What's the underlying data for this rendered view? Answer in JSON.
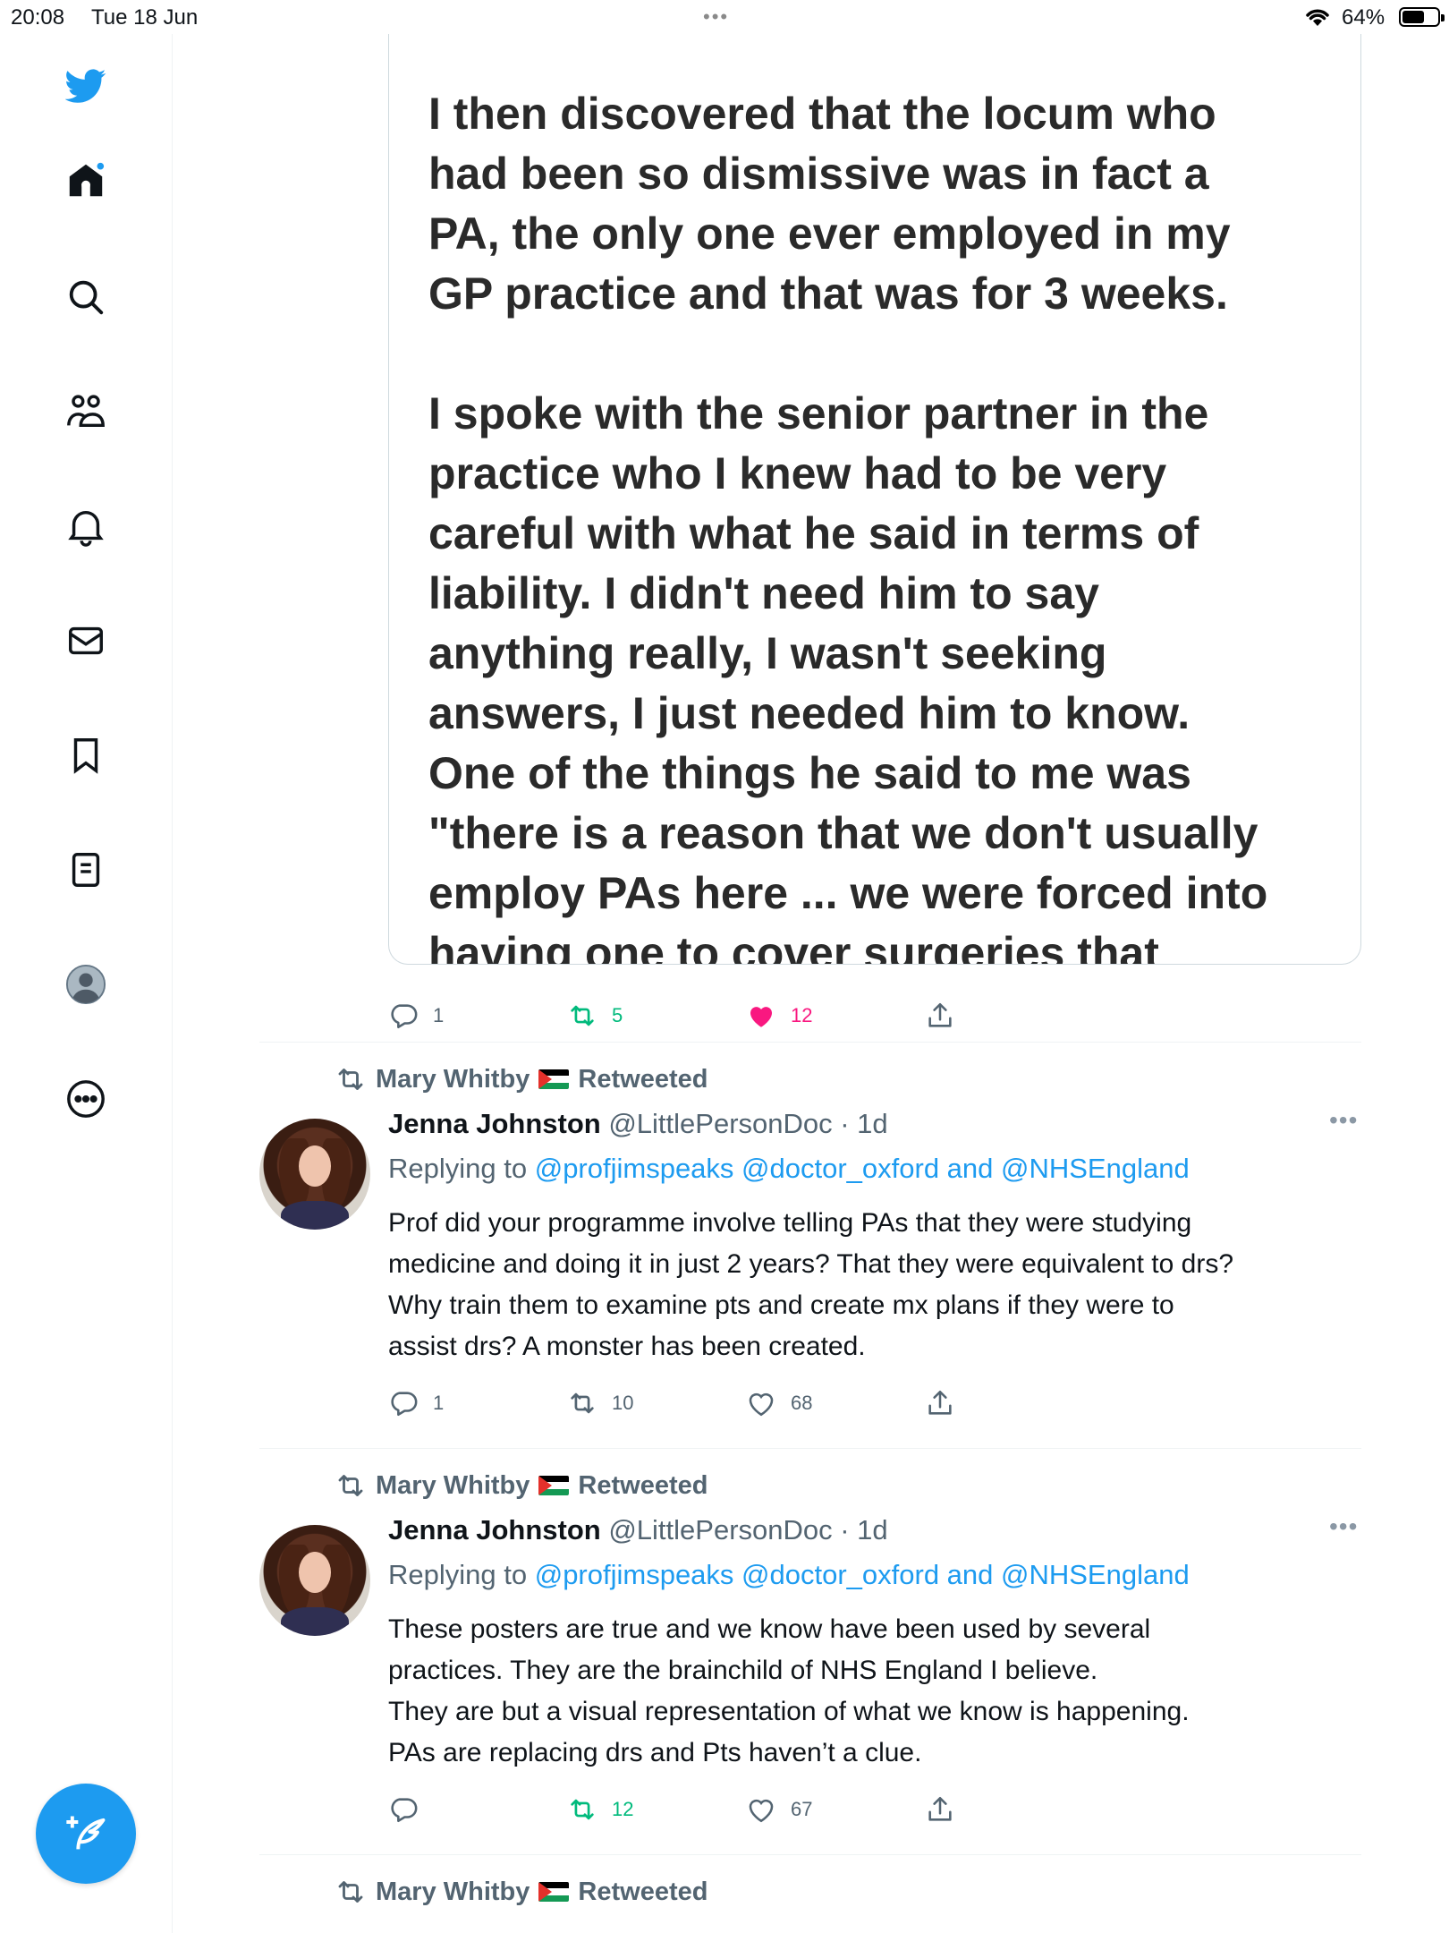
{
  "status_bar": {
    "time": "20:08",
    "date": "Tue 18 Jun",
    "battery_percent": "64%",
    "battery_level": 0.64
  },
  "sidebar": {
    "items": [
      {
        "icon": "twitter-bird-icon"
      },
      {
        "icon": "home-icon",
        "has_notification_dot": true
      },
      {
        "icon": "search-icon"
      },
      {
        "icon": "communities-icon"
      },
      {
        "icon": "bell-icon"
      },
      {
        "icon": "mail-icon"
      },
      {
        "icon": "bookmark-icon"
      },
      {
        "icon": "lists-icon"
      },
      {
        "icon": "profile-icon"
      },
      {
        "icon": "more-icon"
      }
    ],
    "compose_icon": "compose-tweet-icon"
  },
  "colors": {
    "accent": "#1d9bf0",
    "retweet_green": "#00ba7c",
    "like_pink": "#f91880",
    "secondary_text": "#536471"
  },
  "first_tweet": {
    "media_text": "I then discovered that the locum who\nhad been so dismissive was in fact a\nPA, the only one ever employed in my\nGP practice and that was for 3 weeks.\n\nI spoke with the senior partner in the\npractice who I knew had to be very\ncareful with what he said in terms of\nliability. I didn't need him to say\nanything really, I wasn't seeking\nanswers, I just needed him to know.\nOne of the things he said to me was\n\"there is a reason that we don't usually\nemploy PAs here ... we were forced into\nhaving one to cover surgeries that",
    "actions": {
      "replies": "1",
      "retweets": "5",
      "likes": "12"
    }
  },
  "tweets": [
    {
      "retweeted_by": "Mary Whitby",
      "retweeted_label": "Retweeted",
      "name": "Jenna Johnston",
      "handle_time": "@LittlePersonDoc · 1d",
      "replying_prefix": "Replying to ",
      "replying_links": "@profjimspeaks @doctor_oxford and @NHSEngland",
      "text": "Prof did your programme involve telling PAs that they were studying\nmedicine and doing it in just 2 years? That they were equivalent to drs?\nWhy train them to examine pts and create mx plans if they were to\nassist drs? A monster has been created.",
      "actions": {
        "replies": "1",
        "retweets": "10",
        "likes": "68"
      }
    },
    {
      "retweeted_by": "Mary Whitby",
      "retweeted_label": "Retweeted",
      "name": "Jenna Johnston",
      "handle_time": "@LittlePersonDoc · 1d",
      "replying_prefix": "Replying to ",
      "replying_links": "@profjimspeaks @doctor_oxford and @NHSEngland",
      "text": "These posters are true and we know have been used by several\npractices. They are the brainchild of NHS England I believe.\nThey are but a visual representation of what we know is happening.\nPAs are replacing drs and Pts haven’t a clue.",
      "actions": {
        "replies": "",
        "retweets": "12",
        "likes": "67"
      }
    },
    {
      "retweeted_by": "Mary Whitby",
      "retweeted_label": "Retweeted"
    }
  ]
}
